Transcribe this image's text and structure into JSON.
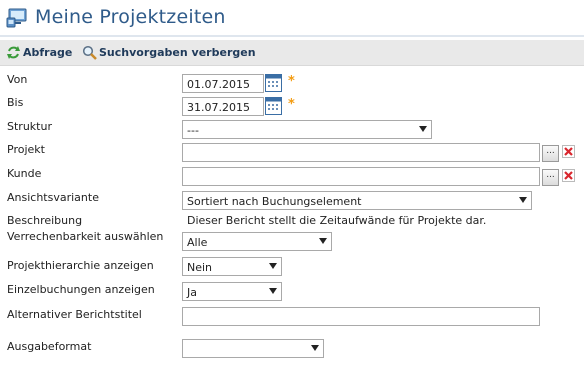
{
  "page": {
    "title": "Meine Projektzeiten"
  },
  "toolbar": {
    "query_label": "Abfrage",
    "hide_label": "Suchvorgaben verbergen"
  },
  "form": {
    "von": {
      "label": "Von",
      "value": "01.07.2015",
      "required_mark": "*"
    },
    "bis": {
      "label": "Bis",
      "value": "31.07.2015",
      "required_mark": "*"
    },
    "struktur": {
      "label": "Struktur",
      "value": "---"
    },
    "projekt": {
      "label": "Projekt",
      "value": "",
      "browse_label": "..."
    },
    "kunde": {
      "label": "Kunde",
      "value": "",
      "browse_label": "..."
    },
    "ansicht": {
      "label": "Ansichtsvariante",
      "value": "Sortiert nach Buchungselement"
    },
    "beschreibung": {
      "label": "Beschreibung",
      "text": "Dieser Bericht stellt die Zeitaufwände für Projekte dar."
    },
    "verrechenbarkeit": {
      "label": "Verrechenbarkeit auswählen",
      "value": "Alle"
    },
    "hierarchie": {
      "label": "Projekthierarchie anzeigen",
      "value": "Nein"
    },
    "einzelbuchungen": {
      "label": "Einzelbuchungen anzeigen",
      "value": "Ja"
    },
    "berichtstitel": {
      "label": "Alternativer Berichtstitel",
      "value": ""
    },
    "ausgabeformat": {
      "label": "Ausgabeformat",
      "value": ""
    }
  },
  "icons": {
    "title": "monitor-icon",
    "query": "refresh-icon",
    "hide": "magnifier-icon",
    "calendar": "calendar-icon",
    "delete": "delete-icon"
  },
  "colors": {
    "title": "#2f5b8a",
    "required": "#f39c12",
    "delete": "#d9262e",
    "toolbar_bg": "#e9e9e9"
  }
}
